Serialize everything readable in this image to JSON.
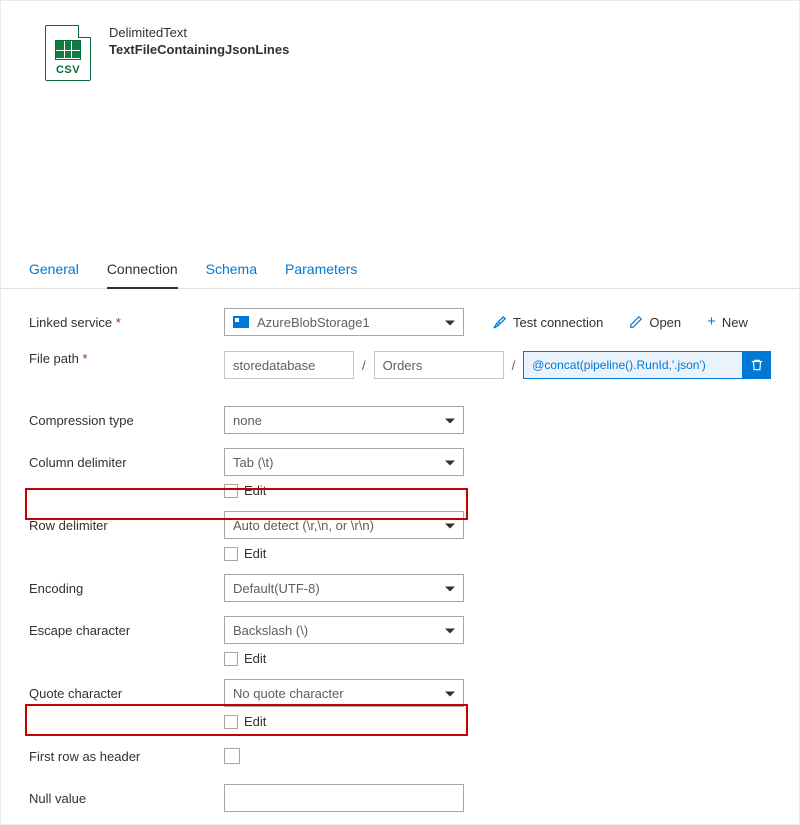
{
  "header": {
    "icon_label": "CSV",
    "type": "DelimitedText",
    "name": "TextFileContainingJsonLines"
  },
  "tabs": {
    "general": "General",
    "connection": "Connection",
    "schema": "Schema",
    "parameters": "Parameters"
  },
  "labels": {
    "linked_service": "Linked service",
    "file_path": "File path",
    "compression_type": "Compression type",
    "column_delimiter": "Column delimiter",
    "row_delimiter": "Row delimiter",
    "encoding": "Encoding",
    "escape_character": "Escape character",
    "quote_character": "Quote character",
    "first_row_as_header": "First row as header",
    "null_value": "Null value",
    "edit": "Edit"
  },
  "values": {
    "linked_service": "AzureBlobStorage1",
    "file_path_store": "storedatabase",
    "file_path_folder": "Orders",
    "file_path_file": "@concat(pipeline().RunId,'.json')",
    "compression_type": "none",
    "column_delimiter": "Tab (\\t)",
    "row_delimiter": "Auto detect (\\r,\\n, or \\r\\n)",
    "encoding": "Default(UTF-8)",
    "escape_character": "Backslash (\\)",
    "quote_character": "No quote character",
    "null_value": ""
  },
  "actions": {
    "test_connection": "Test connection",
    "open": "Open",
    "new": "New"
  }
}
